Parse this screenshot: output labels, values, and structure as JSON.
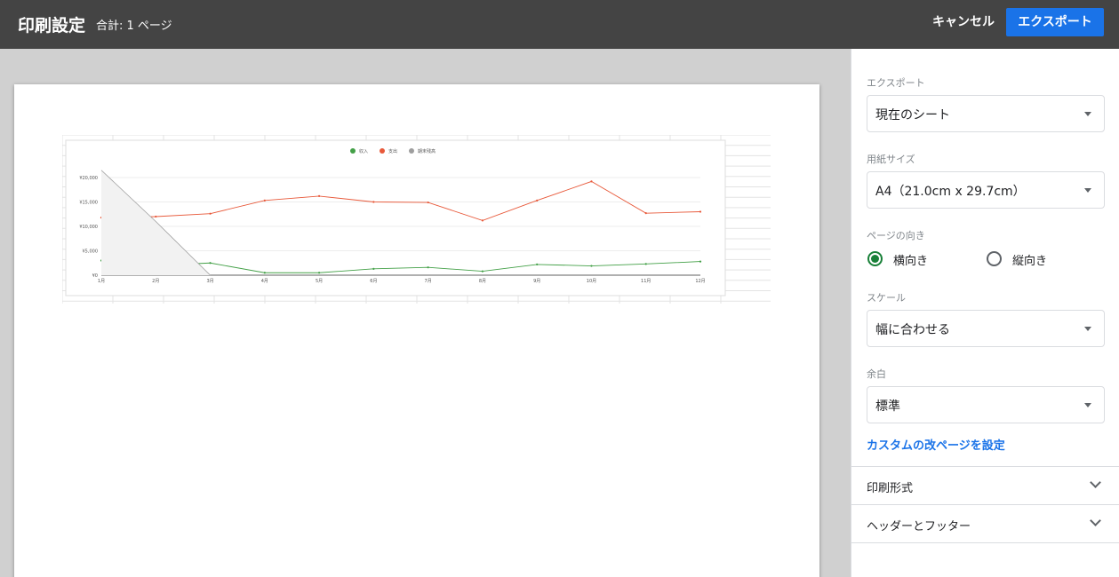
{
  "header": {
    "title": "印刷設定",
    "total_pages": "合計: 1 ページ",
    "cancel_label": "キャンセル",
    "export_label": "エクスポート"
  },
  "panel": {
    "export": {
      "label": "エクスポート",
      "value": "現在のシート"
    },
    "paper_size": {
      "label": "用紙サイズ",
      "value": "A4（21.0cm x 29.7cm）"
    },
    "orientation": {
      "label": "ページの向き",
      "options": [
        "横向き",
        "縦向き"
      ],
      "selected": "横向き"
    },
    "scale": {
      "label": "スケール",
      "value": "幅に合わせる"
    },
    "margins": {
      "label": "余白",
      "value": "標準"
    },
    "custom_page_breaks_link": "カスタムの改ページを設定",
    "sections": [
      {
        "title": "印刷形式"
      },
      {
        "title": "ヘッダーとフッター"
      }
    ]
  },
  "colors": {
    "accent": "#1a73e8",
    "radio_selected": "#188038",
    "income": "#43a047",
    "expense": "#e8593a",
    "balance": "#9e9e9e"
  },
  "chart_data": {
    "type": "line",
    "categories": [
      "1月",
      "2月",
      "3月",
      "4月",
      "5月",
      "6月",
      "7月",
      "8月",
      "9月",
      "10月",
      "11月",
      "12月"
    ],
    "series": [
      {
        "name": "収入",
        "color": "#43a047",
        "values": [
          3000,
          2000,
          2500,
          500,
          500,
          1300,
          1600,
          800,
          2200,
          1900,
          2300,
          2800
        ]
      },
      {
        "name": "支出",
        "color": "#e8593a",
        "values": [
          11800,
          12000,
          12600,
          15300,
          16200,
          15000,
          14900,
          11200,
          15300,
          19200,
          12700,
          13000
        ]
      },
      {
        "name": "期末残高",
        "color": "#9e9e9e",
        "values": [
          21500,
          11000,
          0,
          null,
          null,
          null,
          null,
          null,
          null,
          null,
          null,
          null
        ]
      }
    ],
    "yticks": [
      "¥0",
      "¥5,000",
      "¥10,000",
      "¥15,000",
      "¥20,000"
    ],
    "ylim": [
      0,
      20000
    ],
    "legend_position": "top-center",
    "grid": true
  }
}
